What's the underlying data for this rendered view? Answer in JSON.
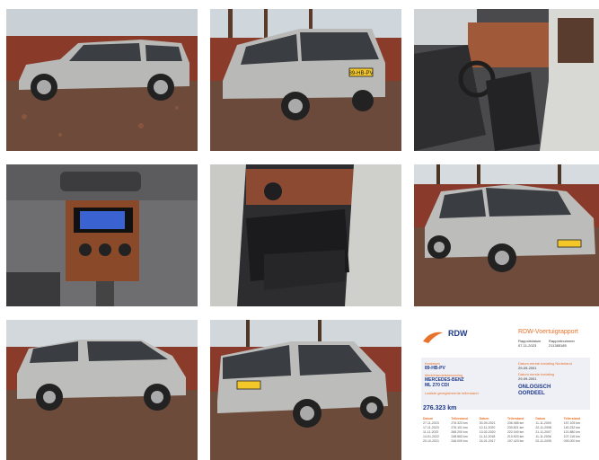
{
  "gallery": {
    "tiles": [
      {
        "name": "photo-suv-side-view",
        "alt": "Silver SUV side view"
      },
      {
        "name": "photo-suv-rear-view",
        "alt": "Silver SUV rear view"
      },
      {
        "name": "photo-driver-interior",
        "alt": "Driver seat interior"
      },
      {
        "name": "photo-dashboard-radio",
        "alt": "Dashboard with radio"
      },
      {
        "name": "photo-rear-seats",
        "alt": "Rear leather seats"
      },
      {
        "name": "photo-suv-front-view",
        "alt": "Silver SUV front view"
      },
      {
        "name": "photo-suv-side-left",
        "alt": "Silver SUV left side"
      },
      {
        "name": "photo-suv-rear-left",
        "alt": "Silver SUV rear left view"
      },
      {
        "name": "rdw-report-thumbnail",
        "alt": "RDW report"
      }
    ],
    "plate_text": "89-HB-PV"
  },
  "rdw": {
    "logo_text": "RDW",
    "report_title": "RDW-Voertuigrapport",
    "meta1_label": "Rapportdatum",
    "meta1_value": "07-11-2023",
    "meta2_label": "Rapportnummer",
    "meta2_value": "211385185",
    "kenteken_label": "Kenteken",
    "kenteken_value": "89-HB-PV",
    "merk_label": "Merk/Handelsbenaming",
    "merk_value": "MERCEDES-BENZ",
    "model_value": "ML 270 CDI",
    "eerste_label": "Datum eerste toelating Nederland",
    "eerste_value": "29-09-2001",
    "tenaam_label": "Datum eerste toelating",
    "tenaam_value": "29-09-2001",
    "oordeel_label": "Laatste geregistreerde tellerstand",
    "oordeel_value": "ONLOGISCH",
    "oordeel_value2": "OORDEEL",
    "km_value": "276.323 km",
    "table_header": [
      "Datum",
      "Tellerstand",
      "Datum",
      "Tellerstand",
      "Datum",
      "Tellerstand"
    ],
    "table_rows": [
      [
        "27-11-2023",
        "276.323 km",
        "30-09-2021",
        "236.985 km",
        "11-11-2009",
        "157.105 km"
      ],
      [
        "17-11-2023",
        "276.101 km",
        "12-11-2020",
        "230.821 km",
        "22-11-2008",
        "140.232 km"
      ],
      [
        "11-11-2022",
        "268.200 km",
        "13-02-2020",
        "222.040 km",
        "21-11-2007",
        "121.880 km"
      ],
      [
        "14-01-2022",
        "248.563 km",
        "11-12-2018",
        "210.520 km",
        "11-11-2006",
        "107.116 km"
      ],
      [
        "20-10-2021",
        "246.009 km",
        "24-01-2017",
        "197.420 km",
        "02-11-2005",
        "093.000 km"
      ]
    ]
  }
}
